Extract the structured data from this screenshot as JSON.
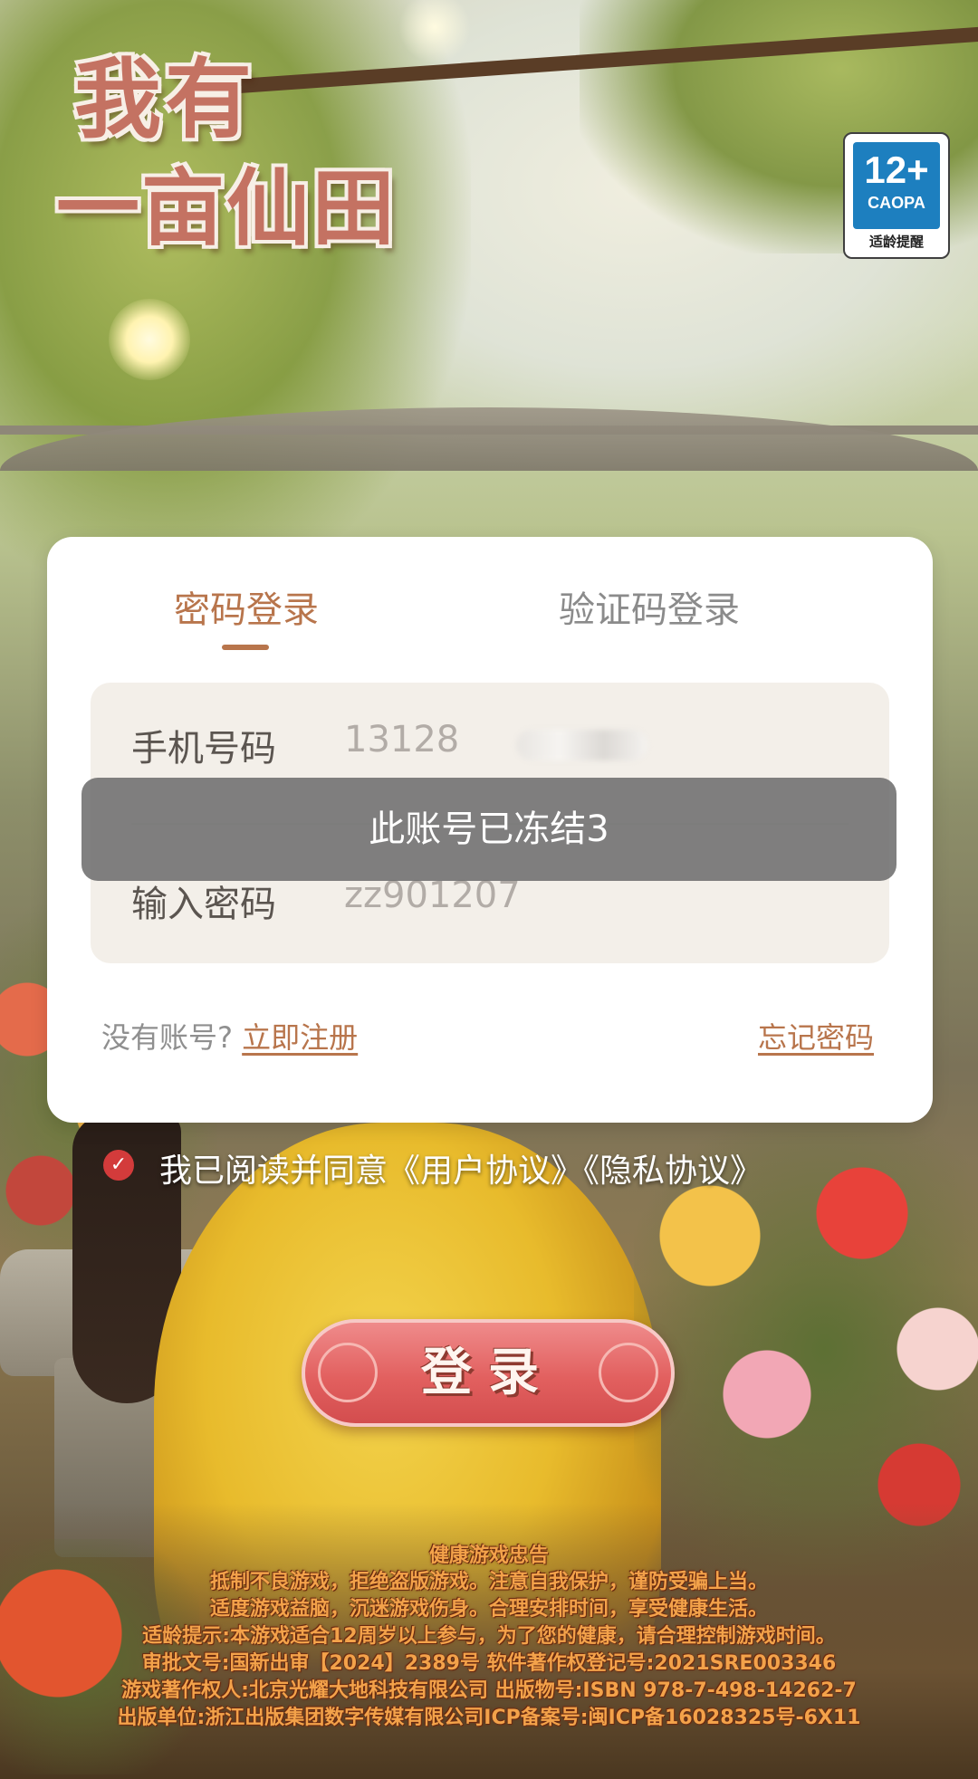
{
  "logo": {
    "line1": "我有",
    "line2": "一亩仙田"
  },
  "age_rating": {
    "rating": "12+",
    "org": "CAOPA",
    "caption": "适龄提醒"
  },
  "login_tabs": [
    {
      "label": "密码登录",
      "active": true
    },
    {
      "label": "验证码登录",
      "active": false
    }
  ],
  "form": {
    "phone": {
      "label": "手机号码",
      "value": "13128"
    },
    "password": {
      "label": "输入密码",
      "value": "zz901207"
    }
  },
  "register": {
    "prompt": "没有账号?",
    "link": "立即注册"
  },
  "forgot_password": "忘记密码",
  "toast": "此账号已冻结3",
  "agreement": {
    "checked": true,
    "text": "我已阅读并同意《用户协议》《隐私协议》"
  },
  "login_button": "登录",
  "health_notice": {
    "title": "健康游戏忠告",
    "lines": [
      "抵制不良游戏，拒绝盗版游戏。注意自我保护，谨防受骗上当。",
      "适度游戏益脑，沉迷游戏伤身。合理安排时间，享受健康生活。",
      "适龄提示:本游戏适合12周岁以上参与，为了您的健康，请合理控制游戏时间。",
      "审批文号:国新出审【2024】2389号 软件著作权登记号:2021SRE003346",
      "游戏著作权人:北京光耀大地科技有限公司 出版物号:ISBN 978-7-498-14262-7",
      "出版单位:浙江出版集团数字传媒有限公司ICP备案号:闽ICP备16028325号-6X11"
    ]
  },
  "colors": {
    "accent": "#b8754c",
    "toast_bg": "#6e6e6e",
    "check": "#d33b3b",
    "button": "#e2605f"
  }
}
